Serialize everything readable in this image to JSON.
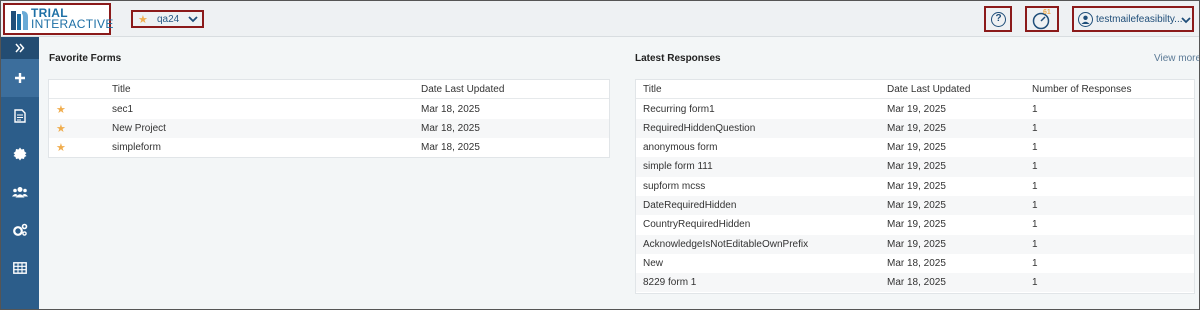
{
  "brand": {
    "line1": "TRIAL",
    "line2": "INTERACTIVE"
  },
  "project": {
    "label": "qa24",
    "icon": "star-icon"
  },
  "header": {
    "help_label": "?",
    "timer_badge": "61",
    "user_name": "testmailefeasibilty..."
  },
  "sidebar": {
    "items": [
      {
        "icon": "expand-icon"
      },
      {
        "icon": "plus-icon"
      },
      {
        "icon": "document-icon"
      },
      {
        "icon": "gear-badge-icon"
      },
      {
        "icon": "users-icon"
      },
      {
        "icon": "cogs-icon"
      },
      {
        "icon": "table-icon"
      }
    ]
  },
  "favorites": {
    "title": "Favorite Forms",
    "columns": [
      "Title",
      "Date Last Updated"
    ],
    "rows": [
      {
        "title": "sec1",
        "date": "Mar 18, 2025"
      },
      {
        "title": "New Project",
        "date": "Mar 18, 2025"
      },
      {
        "title": "simpleform",
        "date": "Mar 18, 2025"
      }
    ]
  },
  "latest": {
    "title": "Latest Responses",
    "view_more": "View more",
    "columns": [
      "Title",
      "Date Last Updated",
      "Number of Responses"
    ],
    "rows": [
      {
        "title": "Recurring form1",
        "date": "Mar 19, 2025",
        "count": "1"
      },
      {
        "title": "RequiredHiddenQuestion",
        "date": "Mar 19, 2025",
        "count": "1"
      },
      {
        "title": "anonymous form",
        "date": "Mar 19, 2025",
        "count": "1"
      },
      {
        "title": "simple form 111",
        "date": "Mar 19, 2025",
        "count": "1"
      },
      {
        "title": "supform mcss",
        "date": "Mar 19, 2025",
        "count": "1"
      },
      {
        "title": "DateRequiredHidden",
        "date": "Mar 19, 2025",
        "count": "1"
      },
      {
        "title": "CountryRequiredHidden",
        "date": "Mar 19, 2025",
        "count": "1"
      },
      {
        "title": "AcknowledgeIsNotEditableOwnPrefix",
        "date": "Mar 19, 2025",
        "count": "1"
      },
      {
        "title": "New",
        "date": "Mar 18, 2025",
        "count": "1"
      },
      {
        "title": "8229 form 1",
        "date": "Mar 18, 2025",
        "count": "1"
      }
    ]
  },
  "colors": {
    "sidebar": "#2c5d8a",
    "accent": "#1d6fa5",
    "star": "#f0ad4e",
    "highlight_border": "#8b1a1a"
  }
}
